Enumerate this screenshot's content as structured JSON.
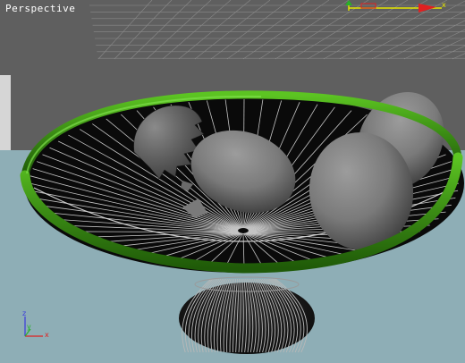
{
  "viewport": {
    "label": "Perspective",
    "label_color": "#ffffff",
    "background_color": "#5f5f5f",
    "ground_color": "#8eaeb6",
    "grid_color": "#8a8a8a"
  },
  "bowl": {
    "rim_color": "#4a9a18",
    "wire_color": "#bcbcbc"
  },
  "eggs": {
    "color": "#8a8a8a"
  },
  "axis_gizmo": {
    "x_label": "x",
    "y_label": "y",
    "z_label": "z",
    "x_color": "#e02020",
    "y_color": "#28b028",
    "z_color": "#3a3adc"
  },
  "transform_gizmo": {
    "x_label": "x",
    "y_color": "#e6e600",
    "x_color": "#e02020"
  }
}
